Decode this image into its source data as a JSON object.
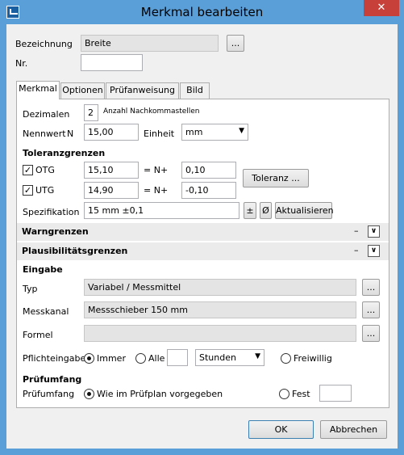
{
  "window": {
    "title": "Merkmal bearbeiten",
    "close": "✕"
  },
  "header": {
    "bezeichnung_label": "Bezeichnung",
    "bezeichnung_value": "Breite",
    "browse_label": "...",
    "nr_label": "Nr.",
    "nr_value": ""
  },
  "tabs": [
    "Merkmal",
    "Optionen",
    "Prüfanweisung",
    "Bild"
  ],
  "merkmal": {
    "dezimalen_label": "Dezimalen",
    "dezimalen_value": "2",
    "dezimalen_hint": "Anzahl Nachkommastellen",
    "nennwert_label": "Nennwert",
    "nennwert_symbol": "N",
    "nennwert_value": "15,00",
    "einheit_label": "Einheit",
    "einheit_value": "mm"
  },
  "toleranz": {
    "heading": "Toleranzgrenzen",
    "otg_label": "OTG",
    "otg_value": "15,10",
    "otg_op": "= N+",
    "otg_offset": "0,10",
    "utg_label": "UTG",
    "utg_value": "14,90",
    "utg_op": "= N+",
    "utg_offset": "-0,10",
    "toleranz_button": "Toleranz ...",
    "spezifikation_label": "Spezifikation",
    "spezifikation_value": "15 mm ±0,1",
    "plusminus_button": "±",
    "diameter_button": "Ø",
    "aktualisieren_button": "Aktualisieren"
  },
  "sections": {
    "warngrenzen": "Warngrenzen",
    "plausibilitaet": "Plausibilitätsgrenzen",
    "dash": "–",
    "chevron": "∨"
  },
  "eingabe": {
    "heading": "Eingabe",
    "typ_label": "Typ",
    "typ_value": "Variabel / Messmittel",
    "messkanal_label": "Messkanal",
    "messkanal_value": "Messschieber 150 mm",
    "formel_label": "Formel",
    "formel_value": "",
    "browse_label": "...",
    "pflicht_label": "Pflichteingabe",
    "immer_label": "Immer",
    "alle_label": "Alle",
    "alle_value": "",
    "interval_value": "Stunden",
    "freiwillig_label": "Freiwillig"
  },
  "pruefumfang": {
    "heading": "Prüfumfang",
    "label": "Prüfumfang",
    "option_plan": "Wie im Prüfplan vorgegeben",
    "option_fest": "Fest",
    "fest_value": ""
  },
  "footer": {
    "ok": "OK",
    "cancel": "Abbrechen"
  }
}
